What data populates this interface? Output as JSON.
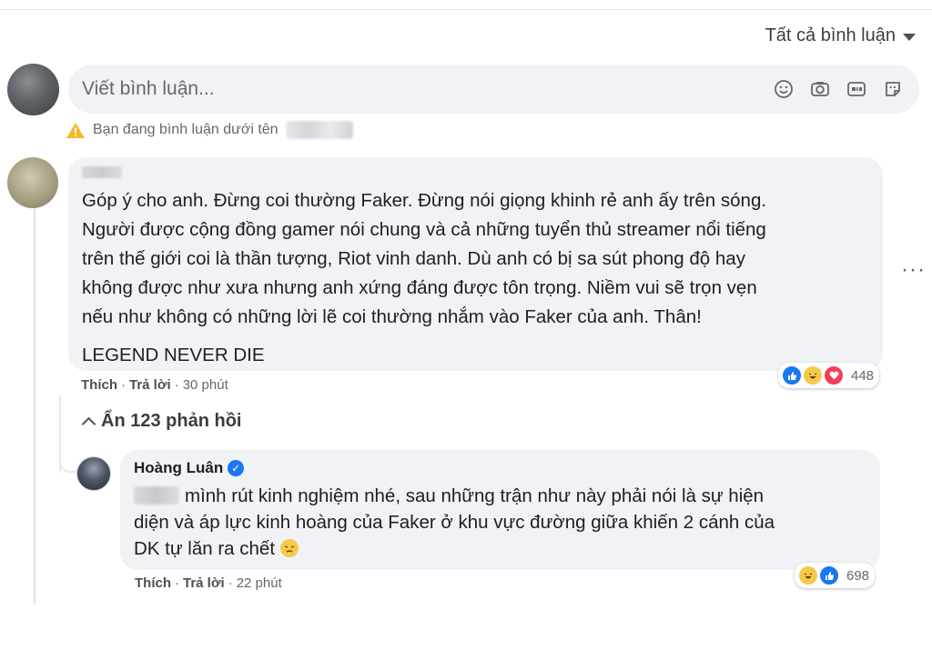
{
  "sort": {
    "label": "Tất cả bình luận"
  },
  "composer": {
    "placeholder": "Viết bình luận...",
    "icons": [
      "smiley-icon",
      "camera-icon",
      "gif-icon",
      "sticker-icon"
    ]
  },
  "notice": {
    "text": "Bạn đang bình luận dưới tên"
  },
  "comment": {
    "lines": [
      "Góp ý cho anh. Đừng coi thường Faker. Đừng nói giọng khinh rẻ anh ấy trên sóng.",
      "Người được cộng đồng gamer nói chung và cả những tuyển thủ streamer nổi tiếng",
      "trên thế giới coi là thần tượng, Riot vinh danh. Dù anh có bị sa sút phong độ hay",
      "không được như xưa nhưng anh xứng đáng được tôn trọng. Niềm vui sẽ trọn vẹn",
      "nếu như không có những lời lẽ coi thường nhắm vào Faker của anh. Thân!"
    ],
    "tagline": "LEGEND NEVER DIE",
    "like": "Thích",
    "reply": "Trả lời",
    "time": "30 phút",
    "reaction_count": "448",
    "separator": "·",
    "more": "···"
  },
  "hide_replies": {
    "label": "Ẩn 123 phản hồi"
  },
  "reply": {
    "author": "Hoàng Luân",
    "verified": "✓",
    "line1": "mình rút kinh nghiệm nhé, sau những trận như này phải nói là sự hiện",
    "line2": "diện và áp lực kinh hoàng của Faker ở khu vực đường giữa khiến 2 cánh của",
    "line3": "DK tự lăn ra chết",
    "like": "Thích",
    "reply": "Trả lời",
    "time": "22 phút",
    "reaction_count": "698",
    "separator": "·"
  },
  "colors": {
    "bubble": "#f0f2f5",
    "meta_text": "#65676b",
    "like_blue": "#1877f2",
    "haha_yellow": "#f7c948",
    "love_red": "#f33e58",
    "warning": "#f7b928"
  }
}
